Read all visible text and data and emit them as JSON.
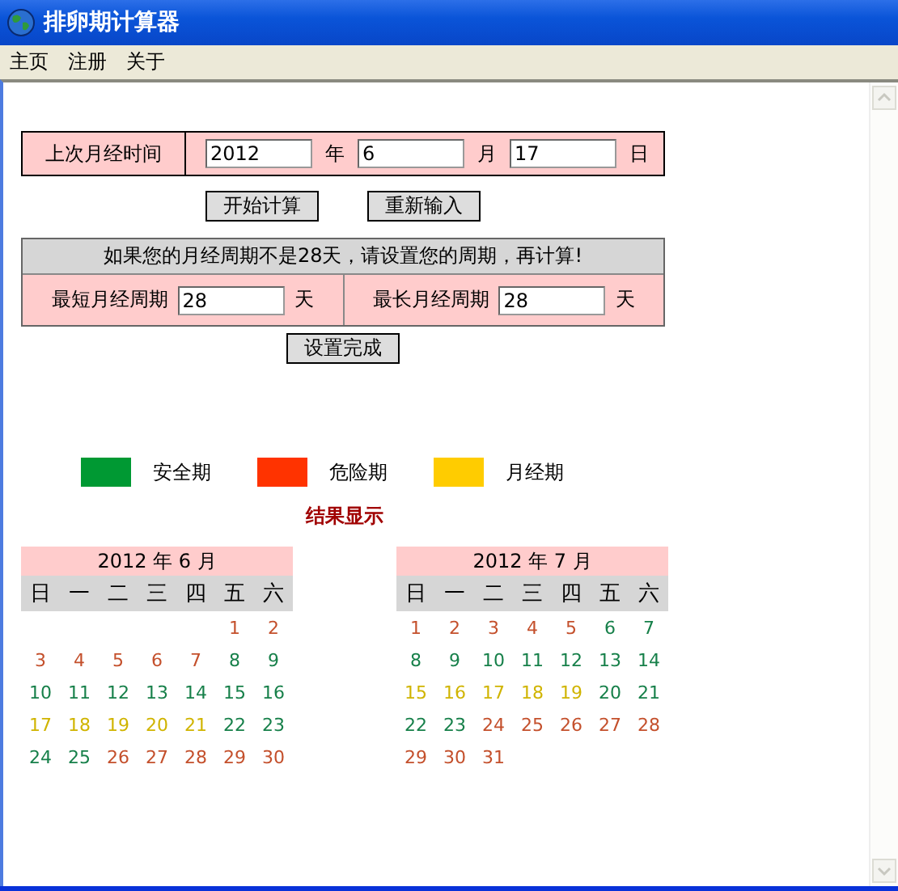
{
  "window": {
    "title": "排卵期计算器"
  },
  "menu": [
    {
      "label": "主页"
    },
    {
      "label": "注册"
    },
    {
      "label": "关于"
    }
  ],
  "last_period": {
    "label": "上次月经时间",
    "year": "2012",
    "year_unit": "年",
    "month": "6",
    "month_unit": "月",
    "day": "17",
    "day_unit": "日"
  },
  "buttons": [
    "开始计算",
    "重新输入"
  ],
  "cycle": {
    "notice": "如果您的月经周期不是28天，请设置您的周期，再计算!",
    "shortest_label": "最短月经周期",
    "shortest": "28",
    "shortest_unit": "天",
    "longest_label": "最长月经周期",
    "longest": "28",
    "longest_unit": "天",
    "button": "设置完成"
  },
  "legend": [
    {
      "label": "安全期",
      "color": "#009933"
    },
    {
      "label": "危险期",
      "color": "#ff3300"
    },
    {
      "label": "月经期",
      "color": "#ffcc00"
    }
  ],
  "result_title": "结果显示",
  "calendars": [
    {
      "title": "2012 年 6 月",
      "weekdays": [
        "日",
        "一",
        "二",
        "三",
        "四",
        "五",
        "六"
      ],
      "weeks": [
        {
          "days": [
            {
              "kind": "blank"
            },
            {
              "kind": "blank"
            },
            {
              "kind": "blank"
            },
            {
              "kind": "blank"
            },
            {
              "kind": "blank"
            },
            {
              "day": "1",
              "kind": "danger"
            },
            {
              "day": "2",
              "kind": "danger"
            }
          ]
        },
        {
          "days": [
            {
              "day": "3",
              "kind": "danger"
            },
            {
              "day": "4",
              "kind": "danger"
            },
            {
              "day": "5",
              "kind": "danger"
            },
            {
              "day": "6",
              "kind": "danger"
            },
            {
              "day": "7",
              "kind": "danger"
            },
            {
              "day": "8",
              "kind": "safe"
            },
            {
              "day": "9",
              "kind": "safe"
            }
          ]
        },
        {
          "days": [
            {
              "day": "10",
              "kind": "safe"
            },
            {
              "day": "11",
              "kind": "safe"
            },
            {
              "day": "12",
              "kind": "safe"
            },
            {
              "day": "13",
              "kind": "safe"
            },
            {
              "day": "14",
              "kind": "safe"
            },
            {
              "day": "15",
              "kind": "safe"
            },
            {
              "day": "16",
              "kind": "safe"
            }
          ]
        },
        {
          "days": [
            {
              "day": "17",
              "kind": "period"
            },
            {
              "day": "18",
              "kind": "period"
            },
            {
              "day": "19",
              "kind": "period"
            },
            {
              "day": "20",
              "kind": "period"
            },
            {
              "day": "21",
              "kind": "period"
            },
            {
              "day": "22",
              "kind": "safe"
            },
            {
              "day": "23",
              "kind": "safe"
            }
          ]
        },
        {
          "days": [
            {
              "day": "24",
              "kind": "safe"
            },
            {
              "day": "25",
              "kind": "safe"
            },
            {
              "day": "26",
              "kind": "danger"
            },
            {
              "day": "27",
              "kind": "danger"
            },
            {
              "day": "28",
              "kind": "danger"
            },
            {
              "day": "29",
              "kind": "danger"
            },
            {
              "day": "30",
              "kind": "danger"
            }
          ]
        }
      ]
    },
    {
      "title": "2012 年 7 月",
      "weekdays": [
        "日",
        "一",
        "二",
        "三",
        "四",
        "五",
        "六"
      ],
      "weeks": [
        {
          "days": [
            {
              "day": "1",
              "kind": "danger"
            },
            {
              "day": "2",
              "kind": "danger"
            },
            {
              "day": "3",
              "kind": "danger"
            },
            {
              "day": "4",
              "kind": "danger"
            },
            {
              "day": "5",
              "kind": "danger"
            },
            {
              "day": "6",
              "kind": "safe"
            },
            {
              "day": "7",
              "kind": "safe"
            }
          ]
        },
        {
          "days": [
            {
              "day": "8",
              "kind": "safe"
            },
            {
              "day": "9",
              "kind": "safe"
            },
            {
              "day": "10",
              "kind": "safe"
            },
            {
              "day": "11",
              "kind": "safe"
            },
            {
              "day": "12",
              "kind": "safe"
            },
            {
              "day": "13",
              "kind": "safe"
            },
            {
              "day": "14",
              "kind": "safe"
            }
          ]
        },
        {
          "days": [
            {
              "day": "15",
              "kind": "period"
            },
            {
              "day": "16",
              "kind": "period"
            },
            {
              "day": "17",
              "kind": "period"
            },
            {
              "day": "18",
              "kind": "period"
            },
            {
              "day": "19",
              "kind": "period"
            },
            {
              "day": "20",
              "kind": "safe"
            },
            {
              "day": "21",
              "kind": "safe"
            }
          ]
        },
        {
          "days": [
            {
              "day": "22",
              "kind": "safe"
            },
            {
              "day": "23",
              "kind": "safe"
            },
            {
              "day": "24",
              "kind": "danger"
            },
            {
              "day": "25",
              "kind": "danger"
            },
            {
              "day": "26",
              "kind": "danger"
            },
            {
              "day": "27",
              "kind": "danger"
            },
            {
              "day": "28",
              "kind": "danger"
            }
          ]
        },
        {
          "days": [
            {
              "day": "29",
              "kind": "danger"
            },
            {
              "day": "30",
              "kind": "danger"
            },
            {
              "day": "31",
              "kind": "danger"
            }
          ]
        }
      ]
    }
  ]
}
